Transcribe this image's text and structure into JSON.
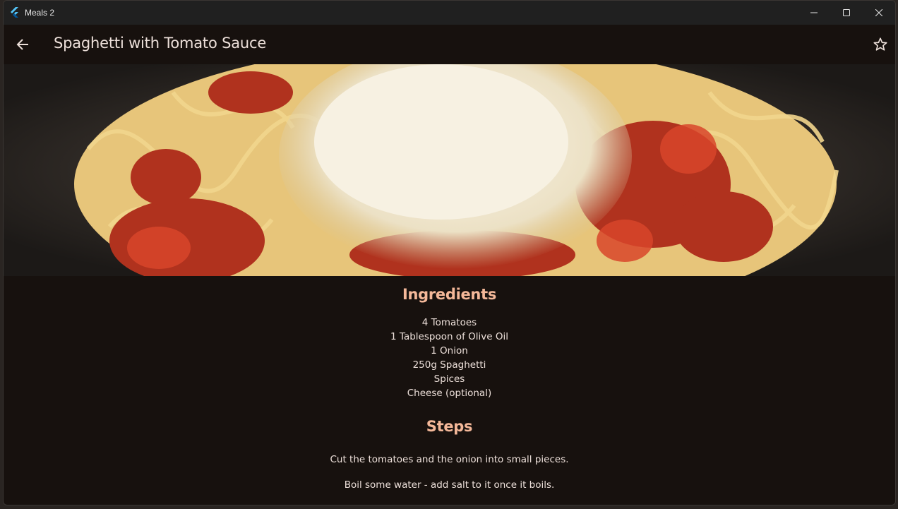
{
  "window": {
    "title": "Meals 2",
    "minimize_icon": "minimize-icon",
    "maximize_icon": "maximize-icon",
    "close_icon": "close-icon"
  },
  "appbar": {
    "title": "Spaghetti with Tomato Sauce",
    "back_icon": "arrow-back-icon",
    "favorite_icon": "star-outline-icon"
  },
  "hero": {
    "alt": "Spaghetti with tomato sauce topped with grated parmesan cheese"
  },
  "ingredients": {
    "title": "Ingredients",
    "items": [
      "4 Tomatoes",
      "1 Tablespoon of Olive Oil",
      "1 Onion",
      "250g Spaghetti",
      "Spices",
      "Cheese (optional)"
    ]
  },
  "steps": {
    "title": "Steps",
    "items": [
      "Cut the tomatoes and the onion into small pieces.",
      "Boil some water - add salt to it once it boils."
    ]
  },
  "colors": {
    "surface": "#17110e",
    "accent": "#f4b899",
    "on_surface": "#ede0da",
    "titlebar": "#202020"
  }
}
